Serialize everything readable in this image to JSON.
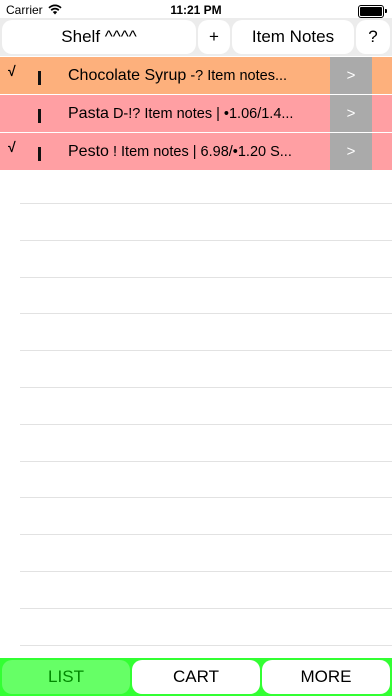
{
  "status_bar": {
    "carrier": "Carrier",
    "time": "11:21 PM",
    "wifi_icon": "wifi-icon",
    "battery_icon": "battery-icon"
  },
  "toolbar": {
    "shelf_label": "Shelf ^^^^",
    "add_label": "+",
    "notes_label": "Item Notes",
    "help_label": "?"
  },
  "items": [
    {
      "check": "√",
      "name": "Chocolate Syrup",
      "detail": "  -? Item notes...",
      "color": "#fdb07c",
      "go": ">"
    },
    {
      "check": "",
      "name": "Pasta",
      "detail": "  D-!? Item notes | •1.06/1.4...",
      "color": "#ff9fa3",
      "go": ">"
    },
    {
      "check": "√",
      "name": "Pesto",
      "detail": "  ! Item notes | 6.98/•1.20 S...",
      "color": "#ff9fa3",
      "go": ">"
    }
  ],
  "tabs": {
    "list": "LIST",
    "cart": "CART",
    "more": "MORE"
  },
  "colors": {
    "toolbar_bg": "#ececec",
    "tabbar_bg": "#33ff33",
    "tab_active_bg": "#66ff66",
    "tab_active_text": "#008800",
    "go_button_bg": "#aaaaaa"
  }
}
